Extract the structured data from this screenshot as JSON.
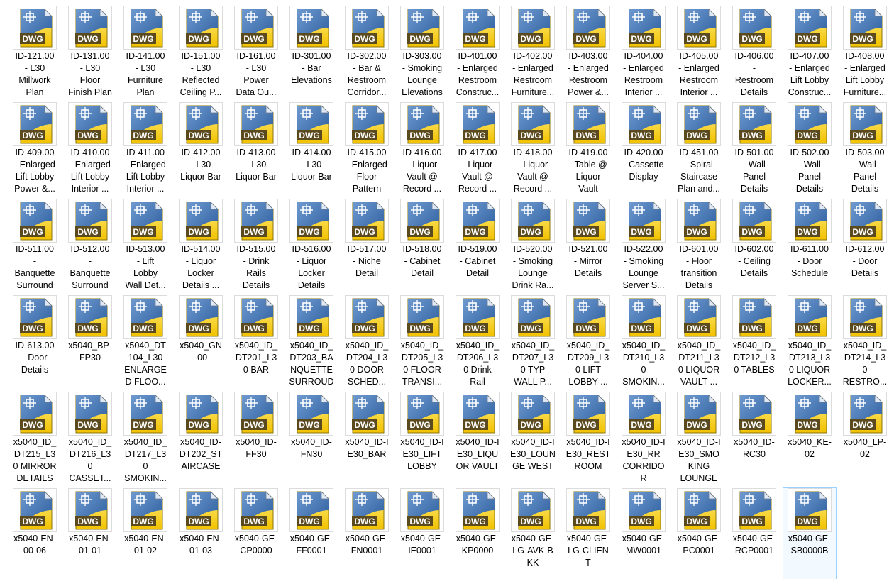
{
  "icon": {
    "name": "dwg-file-icon",
    "badge_text": "DWG",
    "colors": {
      "blue": "#2a5c9c",
      "blue_light": "#6f9ad0",
      "yellow": "#f2c200",
      "yellow_light": "#fff08a",
      "badge": "#5a4a1e"
    }
  },
  "files": [
    [
      "ID-121.00\n- L30\nMillwork\nPlan",
      "ID-131.00\n- L30\nFloor\nFinish Plan",
      "ID-141.00\n- L30\nFurniture\nPlan",
      "ID-151.00\n- L30\nReflected\nCeiling P...",
      "ID-161.00\n- L30\nPower\nData Ou...",
      "ID-301.00\n- Bar\nElevations",
      "ID-302.00\n- Bar &\nRestroom\nCorridor...",
      "ID-303.00\n- Smoking\nLounge\nElevations",
      "ID-401.00\n- Enlarged\nRestroom\nConstruc...",
      "ID-402.00\n- Enlarged\nRestroom\nFurniture...",
      "ID-403.00\n- Enlarged\nRestroom\nPower &...",
      "ID-404.00\n- Enlarged\nRestroom\nInterior ...",
      "ID-405.00\n- Enlarged\nRestroom\nInterior ...",
      "ID-406.00\n-\nRestroom\nDetails",
      "ID-407.00\n- Enlarged\nLift Lobby\nConstruc...",
      "ID-408.00\n- Enlarged\nLift Lobby\nFurniture..."
    ],
    [
      "ID-409.00\n- Enlarged\nLift Lobby\nPower &...",
      "ID-410.00\n- Enlarged\nLift Lobby\nInterior ...",
      "ID-411.00\n- Enlarged\nLift Lobby\nInterior ...",
      "ID-412.00\n- L30\nLiquor Bar",
      "ID-413.00\n- L30\nLiquor Bar",
      "ID-414.00\n- L30\nLiquor Bar",
      "ID-415.00\n- Enlarged\nFloor\nPattern",
      "ID-416.00\n- Liquor\nVault @\nRecord ...",
      "ID-417.00\n- Liquor\nVault @\nRecord ...",
      "ID-418.00\n- Liquor\nVault @\nRecord ...",
      "ID-419.00\n- Table @\nLiquor\nVault",
      "ID-420.00\n- Cassette\nDisplay",
      "ID-451.00\n- Spiral\nStaircase\nPlan and...",
      "ID-501.00\n- Wall\nPanel\nDetails",
      "ID-502.00\n- Wall\nPanel\nDetails",
      "ID-503.00\n- Wall\nPanel\nDetails"
    ],
    [
      "ID-511.00\n-\nBanquette\nSurround",
      "ID-512.00\n-\nBanquette\nSurround",
      "ID-513.00\n- Lift\nLobby\nWall Det...",
      "ID-514.00\n- Liquor\nLocker\nDetails ...",
      "ID-515.00\n- Drink\nRails\nDetails",
      "ID-516.00\n- Liquor\nLocker\nDetails",
      "ID-517.00\n- Niche\nDetail",
      "ID-518.00\n- Cabinet\nDetail",
      "ID-519.00\n- Cabinet\nDetail",
      "ID-520.00\n- Smoking\nLounge\nDrink Ra...",
      "ID-521.00\n- Mirror\nDetails",
      "ID-522.00\n- Smoking\nLounge\nServer S...",
      "ID-601.00\n- Floor\ntransition\nDetails",
      "ID-602.00\n- Ceiling\nDetails",
      "ID-611.00\n- Door\nSchedule",
      "ID-612.00\n- Door\nDetails"
    ],
    [
      "ID-613.00\n- Door\nDetails",
      "x5040_BP-\nFP30",
      "x5040_DT\n104_L30\nENLARGE\nD FLOO...",
      "x5040_GN\n-00",
      "x5040_ID_\nDT201_L3\n0 BAR",
      "x5040_ID_\nDT203_BA\nNQUETTE\nSURROUD",
      "x5040_ID_\nDT204_L3\n0 DOOR\nSCHED...",
      "x5040_ID_\nDT205_L3\n0 FLOOR\nTRANSI...",
      "x5040_ID_\nDT206_L3\n0 Drink\nRail",
      "x5040_ID_\nDT207_L3\n0 TYP\nWALL P...",
      "x5040_ID_\nDT209_L3\n0 LIFT\nLOBBY ...",
      "x5040_ID_\nDT210_L3\n0\nSMOKIN...",
      "x5040_ID_\nDT211_L3\n0 LIQUOR\nVAULT ...",
      "x5040_ID_\nDT212_L3\n0 TABLES",
      "x5040_ID_\nDT213_L3\n0 LIQUOR\nLOCKER...",
      "x5040_ID_\nDT214_L3\n0\nRESTRO..."
    ],
    [
      "x5040_ID_\nDT215_L3\n0 MIRROR\nDETAILS",
      "x5040_ID_\nDT216_L3\n0\nCASSET...",
      "x5040_ID_\nDT217_L3\n0\nSMOKIN...",
      "x5040_ID-\nDT202_ST\nAIRCASE",
      "x5040_ID-\nFF30",
      "x5040_ID-\nFN30",
      "x5040_ID-I\nE30_BAR",
      "x5040_ID-I\nE30_LIFT\nLOBBY",
      "x5040_ID-I\nE30_LIQU\nOR VAULT",
      "x5040_ID-I\nE30_LOUN\nGE WEST",
      "x5040_ID-I\nE30_REST\nROOM",
      "x5040_ID-I\nE30_RR\nCORRIDO\nR",
      "x5040_ID-I\nE30_SMO\nKING\nLOUNGE",
      "x5040_ID-\nRC30",
      "x5040_KE-\n02",
      "x5040_LP-\n02"
    ],
    [
      "x5040-EN-\n00-06",
      "x5040-EN-\n01-01",
      "x5040-EN-\n01-02",
      "x5040-EN-\n01-03",
      "x5040-GE-\nCP0000",
      "x5040-GE-\nFF0001",
      "x5040-GE-\nFN0001",
      "x5040-GE-\nIE0001",
      "x5040-GE-\nKP0000",
      "x5040-GE-\nLG-AVK-B\nKK",
      "x5040-GE-\nLG-CLIEN\nT",
      "x5040-GE-\nMW0001",
      "x5040-GE-\nPC0001",
      "x5040-GE-\nRCP0001",
      "x5040-GE-\nSB0000B"
    ]
  ],
  "selected": {
    "row": 5,
    "col": 14
  }
}
